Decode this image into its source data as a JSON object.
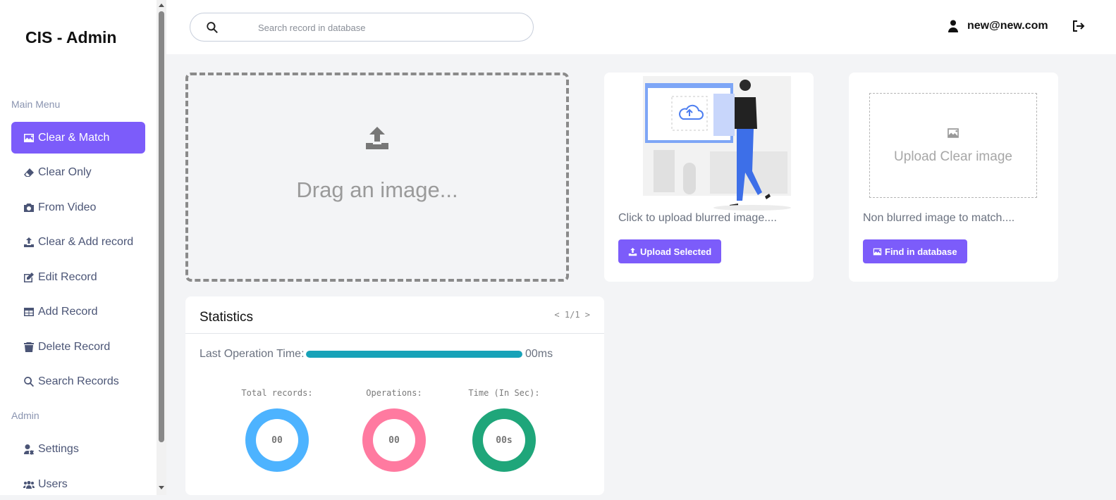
{
  "sidebar": {
    "brand": "CIS - Admin",
    "main_menu_label": "Main Menu",
    "admin_label": "Admin",
    "items": [
      {
        "label": "Clear & Match",
        "icon": "image-icon",
        "active": true
      },
      {
        "label": "Clear Only",
        "icon": "eraser-icon"
      },
      {
        "label": "From Video",
        "icon": "camera-icon"
      },
      {
        "label": "Clear & Add record",
        "icon": "upload-icon"
      },
      {
        "label": "Edit Record",
        "icon": "edit-icon"
      },
      {
        "label": "Add Record",
        "icon": "table-icon"
      },
      {
        "label": "Delete Record",
        "icon": "trash-icon"
      },
      {
        "label": "Search Records",
        "icon": "search-icon"
      }
    ],
    "admin_items": [
      {
        "label": "Settings",
        "icon": "user-gear-icon"
      },
      {
        "label": "Users",
        "icon": "users-icon"
      }
    ]
  },
  "header": {
    "search_placeholder": "Search record in database",
    "user_email": "new@new.com"
  },
  "dropzone": {
    "text": "Drag an image..."
  },
  "blurred_card": {
    "text": "Click to upload blurred image....",
    "button_label": "Upload Selected"
  },
  "clear_card": {
    "box_text": "Upload Clear image",
    "text": "Non blurred image to match....",
    "button_label": "Find in database"
  },
  "statistics": {
    "title": "Statistics",
    "pager": "< 1/1 >",
    "last_op_label": "Last Operation Time:",
    "last_op_value": "00ms",
    "last_op_progress": 1.0,
    "metrics": [
      {
        "label": "Total records:",
        "value": "00",
        "color": "#4db3ff"
      },
      {
        "label": "Operations:",
        "value": "00",
        "color": "#ff7aa0"
      },
      {
        "label": "Time (In Sec):",
        "value": "00s",
        "color": "#1fa67a"
      }
    ]
  },
  "colors": {
    "accent": "#7c5cfa",
    "progress": "#17a2b8"
  }
}
